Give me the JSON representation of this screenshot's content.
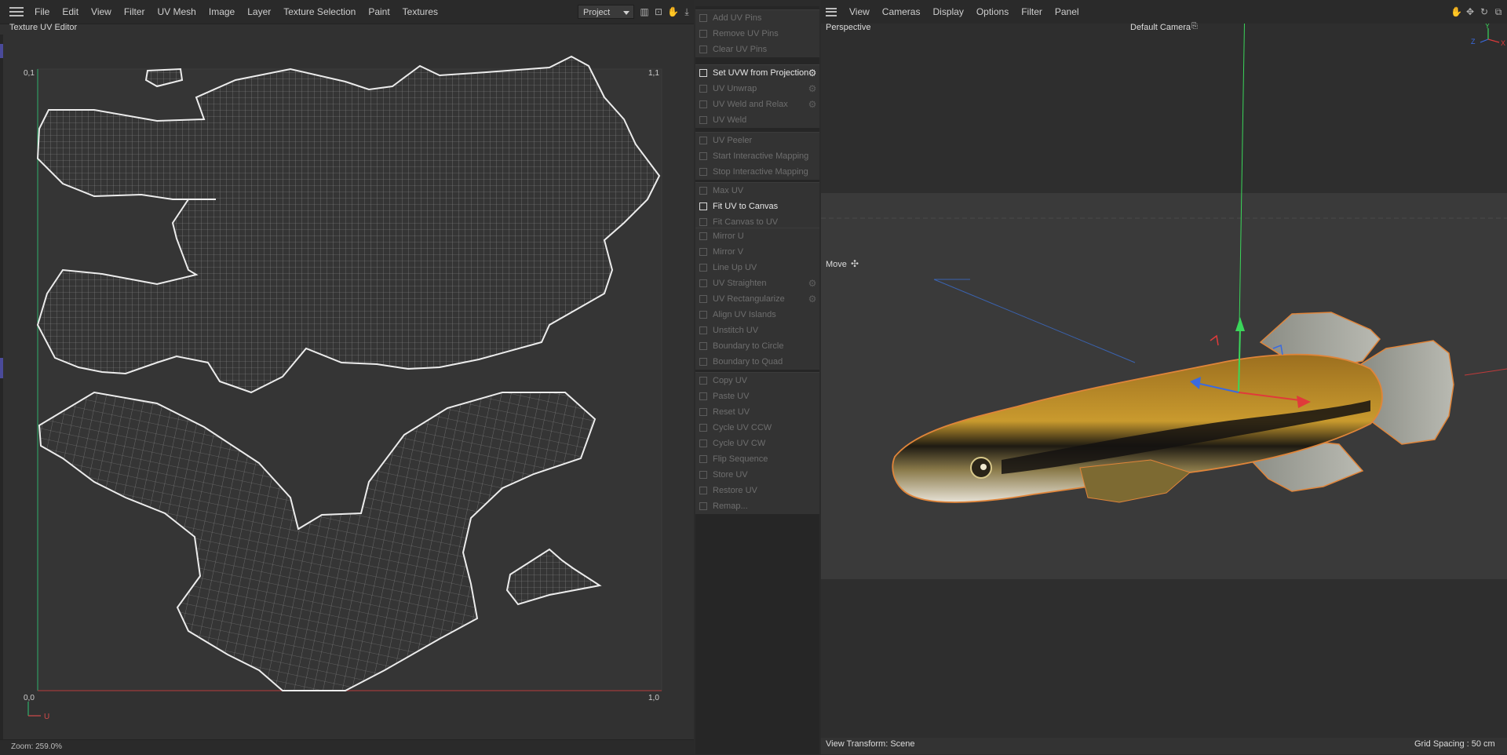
{
  "uv_editor": {
    "menu": [
      "File",
      "Edit",
      "View",
      "Filter",
      "UV Mesh",
      "Image",
      "Layer",
      "Texture Selection",
      "Paint",
      "Textures"
    ],
    "mode_select": "Project",
    "panel_title": "Texture UV Editor",
    "corner_labels": {
      "top_left": "0,1",
      "top_right": "1,1",
      "bottom_left": "0,0",
      "bottom_right": "1,0",
      "axis_u": "U"
    },
    "status": "Zoom: 259.0%"
  },
  "commands": {
    "groups": [
      {
        "items": [
          {
            "label": "Add UV Pins",
            "enabled": false,
            "icon": "pin-add-icon"
          },
          {
            "label": "Remove UV Pins",
            "enabled": false,
            "icon": "pin-remove-icon"
          },
          {
            "label": "Clear UV Pins",
            "enabled": false,
            "icon": "clear-icon"
          }
        ]
      },
      {
        "items": [
          {
            "label": "Set UVW from Projection",
            "enabled": true,
            "gear": true,
            "icon": "projection-icon"
          },
          {
            "label": "UV Unwrap",
            "enabled": false,
            "gear": true,
            "icon": "unwrap-icon"
          },
          {
            "label": "UV Weld and Relax",
            "enabled": false,
            "gear": true,
            "icon": "weld-relax-icon"
          },
          {
            "label": "UV Weld",
            "enabled": false,
            "icon": "weld-icon"
          }
        ]
      },
      {
        "items": [
          {
            "label": "UV Peeler",
            "enabled": false,
            "icon": "peeler-icon"
          },
          {
            "label": "Start Interactive Mapping",
            "enabled": false,
            "icon": "play-icon"
          },
          {
            "label": "Stop Interactive Mapping",
            "enabled": false,
            "icon": "stop-icon"
          }
        ]
      },
      {
        "items": [
          {
            "label": "Max UV",
            "enabled": false,
            "icon": "max-icon"
          },
          {
            "label": "Fit UV to Canvas",
            "enabled": true,
            "icon": "fit-icon"
          },
          {
            "label": "Fit Canvas to UV",
            "enabled": false,
            "icon": "fit-canvas-icon"
          }
        ]
      },
      {
        "items": [
          {
            "label": "Mirror U",
            "enabled": false,
            "icon": "mirror-u-icon"
          },
          {
            "label": "Mirror V",
            "enabled": false,
            "icon": "mirror-v-icon"
          },
          {
            "label": "Line Up UV",
            "enabled": false,
            "icon": "line-up-icon"
          },
          {
            "label": "UV Straighten",
            "enabled": false,
            "gear": true,
            "icon": "straighten-icon"
          },
          {
            "label": "UV Rectangularize",
            "enabled": false,
            "gear": true,
            "icon": "rectangularize-icon"
          },
          {
            "label": "Align UV Islands",
            "enabled": false,
            "icon": "align-icon"
          },
          {
            "label": "Unstitch UV",
            "enabled": false,
            "icon": "unstitch-icon"
          },
          {
            "label": "Boundary to Circle",
            "enabled": false,
            "icon": "circle-icon"
          },
          {
            "label": "Boundary to Quad",
            "enabled": false,
            "icon": "quad-icon"
          }
        ]
      },
      {
        "items": [
          {
            "label": "Copy UV",
            "enabled": false,
            "icon": "copy-icon"
          },
          {
            "label": "Paste UV",
            "enabled": false,
            "icon": "paste-icon"
          },
          {
            "label": "Reset UV",
            "enabled": false,
            "icon": "reset-icon"
          },
          {
            "label": "Cycle UV CCW",
            "enabled": false,
            "icon": "cycle-ccw-icon"
          },
          {
            "label": "Cycle UV CW",
            "enabled": false,
            "icon": "cycle-cw-icon"
          },
          {
            "label": "Flip Sequence",
            "enabled": false,
            "icon": "flip-icon"
          },
          {
            "label": "Store UV",
            "enabled": false,
            "icon": "store-icon"
          },
          {
            "label": "Restore UV",
            "enabled": false,
            "icon": "restore-icon"
          },
          {
            "label": "Remap...",
            "enabled": false,
            "icon": "remap-icon"
          }
        ]
      }
    ]
  },
  "viewport": {
    "menu": [
      "View",
      "Cameras",
      "Display",
      "Options",
      "Filter",
      "Panel"
    ],
    "projection": "Perspective",
    "camera": "Default Camera",
    "tool": "Move",
    "view_transform": "View Transform: Scene",
    "grid_spacing": "Grid Spacing : 50 cm",
    "axis_labels": [
      "Y",
      "Z",
      "X"
    ]
  },
  "colors": {
    "selection_outline": "#e0853a",
    "axis_x": "#e03a3a",
    "axis_y": "#3ad65a",
    "axis_z": "#3a6ae0",
    "uv_wire": "#d8d8d8"
  }
}
